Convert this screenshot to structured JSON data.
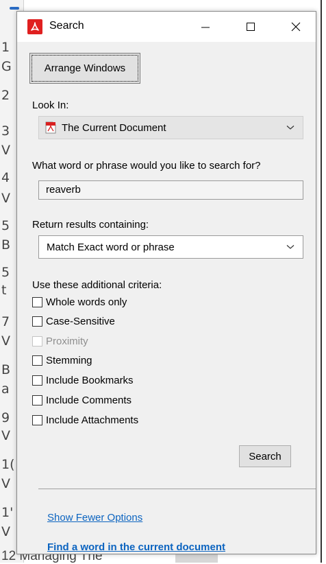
{
  "background": {
    "left_numbers": [
      "1",
      "G",
      "2",
      "3",
      "V",
      "4",
      "V",
      "5",
      "B",
      "5",
      "t",
      "7",
      "V",
      "B",
      "a",
      "9",
      "V",
      "1(",
      "V",
      "1'",
      "V"
    ],
    "bottom_text": "12 Managing The"
  },
  "window": {
    "title": "Search",
    "icons": {
      "app": "acrobat-icon",
      "minimize": "minimize-icon",
      "maximize": "maximize-icon",
      "close": "close-icon"
    }
  },
  "arrange_button": "Arrange Windows",
  "look_in": {
    "label": "Look In:",
    "value": "The Current Document",
    "icon": "pdf-document-icon"
  },
  "search_phrase": {
    "label": "What word or phrase would you like to search for?",
    "value": "reaverb"
  },
  "return_results": {
    "label": "Return results containing:",
    "value": "Match Exact word or phrase"
  },
  "criteria": {
    "label": "Use these additional criteria:",
    "options": [
      {
        "label": "Whole words only",
        "checked": false,
        "enabled": true
      },
      {
        "label": "Case-Sensitive",
        "checked": false,
        "enabled": true
      },
      {
        "label": "Proximity",
        "checked": false,
        "enabled": false
      },
      {
        "label": "Stemming",
        "checked": false,
        "enabled": true
      },
      {
        "label": "Include Bookmarks",
        "checked": false,
        "enabled": true
      },
      {
        "label": "Include Comments",
        "checked": false,
        "enabled": true
      },
      {
        "label": "Include Attachments",
        "checked": false,
        "enabled": true
      }
    ]
  },
  "search_button": "Search",
  "links": {
    "fewer_options": "Show Fewer Options",
    "find_word": "Find a word in the current document"
  },
  "colors": {
    "link": "#0c64c0",
    "acrobat_red": "#e02020",
    "dialog_bg": "#f0f0f0"
  }
}
